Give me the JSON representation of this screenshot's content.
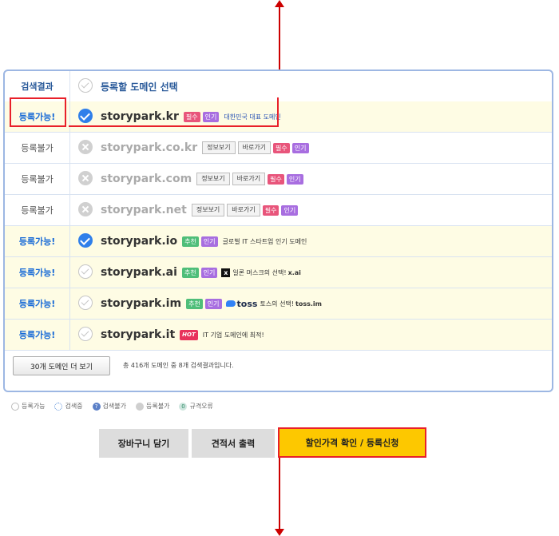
{
  "header": {
    "status_label": "검색결과",
    "title": "등록할 도메인 선택"
  },
  "rows": [
    {
      "status": "등록가능!",
      "domain": "storypark.kr",
      "tags": [
        "필수",
        "인기"
      ],
      "desc": "대한민국 대표 도메인"
    },
    {
      "status": "등록불가",
      "domain": "storypark.co.kr",
      "info": "정보보기",
      "go": "바로가기",
      "tags": [
        "필수",
        "인기"
      ]
    },
    {
      "status": "등록불가",
      "domain": "storypark.com",
      "info": "정보보기",
      "go": "바로가기",
      "tags": [
        "필수",
        "인기"
      ]
    },
    {
      "status": "등록불가",
      "domain": "storypark.net",
      "info": "정보보기",
      "go": "바로가기",
      "tags": [
        "필수",
        "인기"
      ]
    },
    {
      "status": "등록가능!",
      "domain": "storypark.io",
      "tags": [
        "추천",
        "인기"
      ],
      "desc": "글로벌 IT 스타트업 인기 도메인"
    },
    {
      "status": "등록가능!",
      "domain": "storypark.ai",
      "tags": [
        "추천",
        "인기"
      ],
      "desc": "일론 머스크의 선택!",
      "desc_bold": "x.ai",
      "logo": "x"
    },
    {
      "status": "등록가능!",
      "domain": "storypark.im",
      "tags": [
        "추천",
        "인기"
      ],
      "logo_text": "toss",
      "desc": "토스의 선택!",
      "desc_bold": "toss.im"
    },
    {
      "status": "등록가능!",
      "domain": "storypark.it",
      "tags": [
        "HOT"
      ],
      "desc": "IT 기업 도메인에 최적!"
    }
  ],
  "more_button": "30개 도메인 더 보기",
  "summary": "총 416개 도메인 중 8개 검색결과입니다.",
  "legend": [
    "등록가능",
    "검색중",
    "검색불가",
    "등록불가",
    "규격오류"
  ],
  "legend_glyphs": {
    "q": "?",
    "err": "0"
  },
  "buttons": {
    "cart": "장바구니 담기",
    "quote": "견적서 출력",
    "apply": "할인가격 확인 / 등록신청"
  },
  "colors": {
    "accent": "#2f7fea",
    "apply_bg": "#fdc800",
    "highlight": "#e8202a"
  }
}
